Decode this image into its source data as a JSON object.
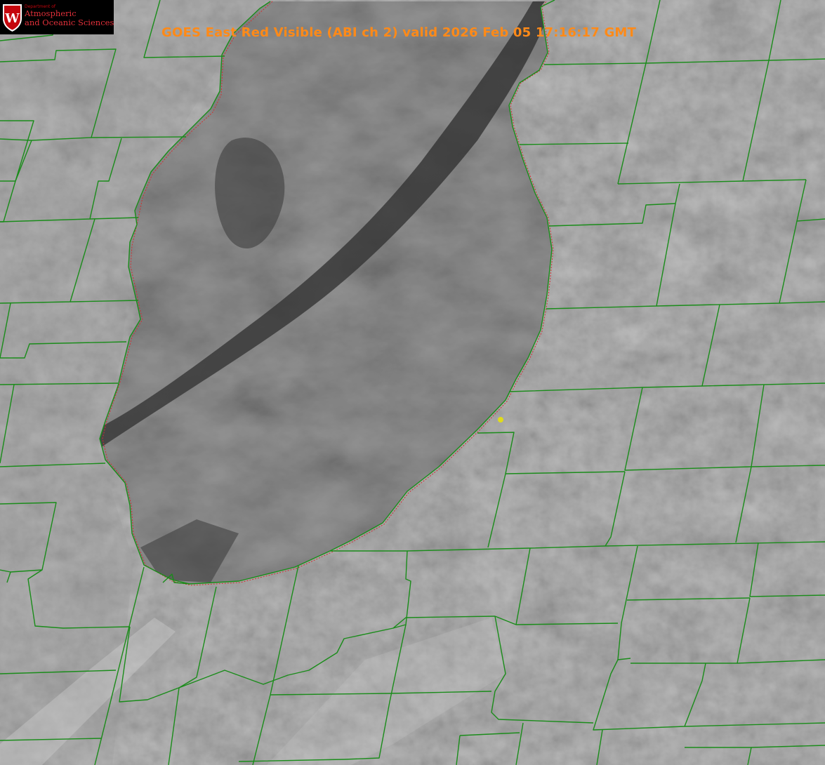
{
  "logo": {
    "department_line": "Department of",
    "name_line1": "Atmospheric",
    "name_line2": "and Oceanic Sciences",
    "seal_letter": "W",
    "seal_color": "#c5050c"
  },
  "title": "GOES East Red Visible (ABI ch 2) valid 2026 Feb 05 17:16:17 GMT",
  "colors": {
    "title": "#ff8a18",
    "county_lines": "#1a8c1a",
    "state_lines": "#d03030",
    "marker": "#e0dc1a",
    "imagery_base": "#7a7a7a"
  },
  "map": {
    "imagery": "satellite-visible-grayscale",
    "feature_water": "lake-michigan",
    "marker": "yellow-dot-station"
  }
}
